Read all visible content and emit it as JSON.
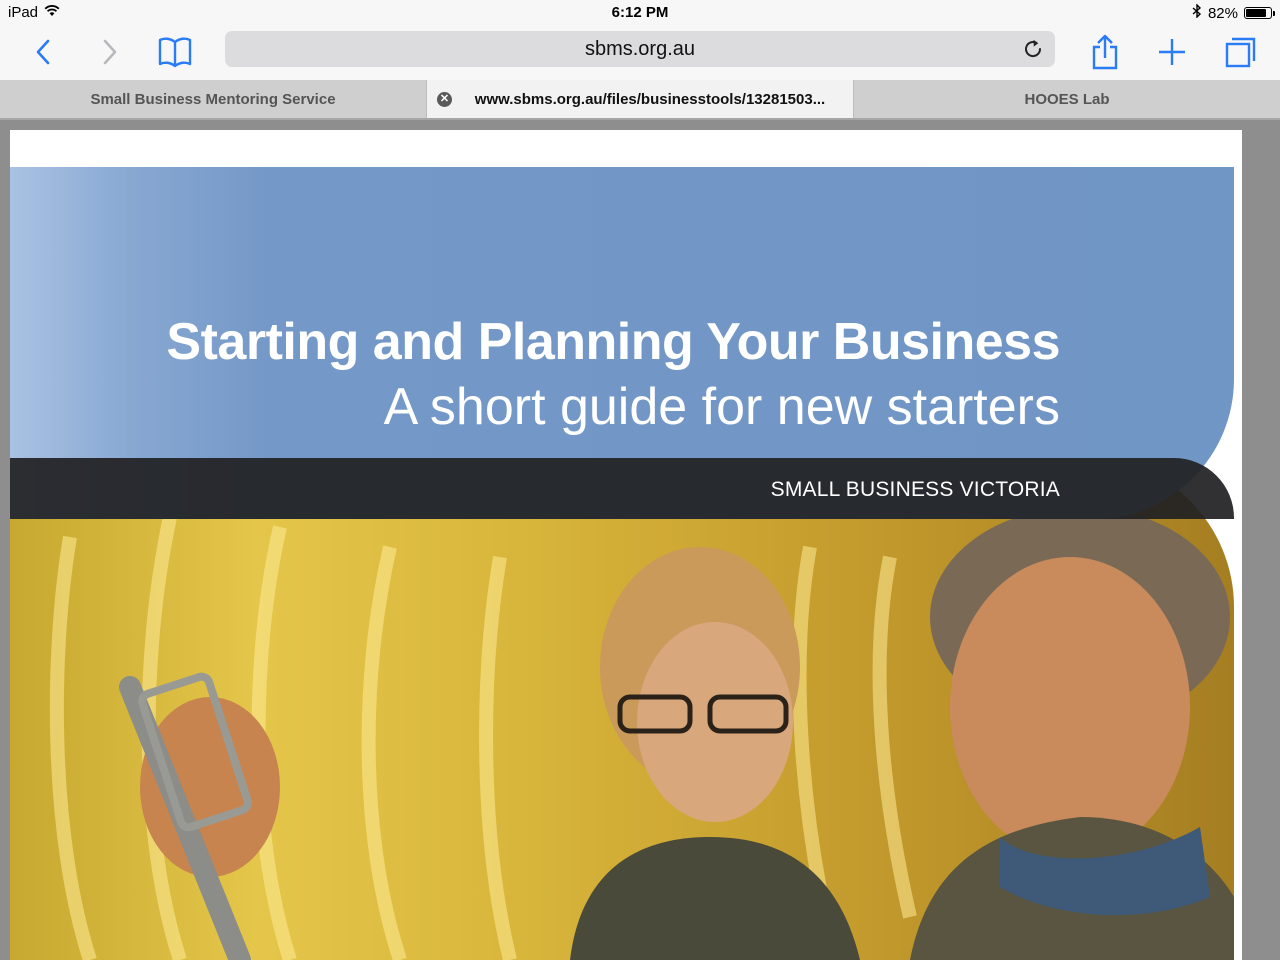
{
  "status_bar": {
    "device": "iPad",
    "time": "6:12 PM",
    "battery": "82%",
    "battery_level": 0.82
  },
  "toolbar": {
    "back_icon": "chevron-left-icon",
    "forward_icon": "chevron-right-icon",
    "bookmarks_icon": "open-book-icon",
    "url": "sbms.org.au",
    "reload_icon": "reload-icon",
    "share_icon": "share-icon",
    "new_tab_icon": "plus-icon",
    "tabs_icon": "tabs-icon",
    "accent_color": "#2a7bf6"
  },
  "tabs": [
    {
      "title": "Small Business Mentoring Service",
      "active": false
    },
    {
      "title": "www.sbms.org.au/files/businesstools/13281503...",
      "active": true
    },
    {
      "title": "HOOES Lab",
      "active": false
    }
  ],
  "document": {
    "title": "Starting and Planning Your Business",
    "subtitle": "A short guide for new starters",
    "brand": "SMALL BUSINESS VICTORIA",
    "panel_color": "#7096c6",
    "band_color": "#212124"
  }
}
